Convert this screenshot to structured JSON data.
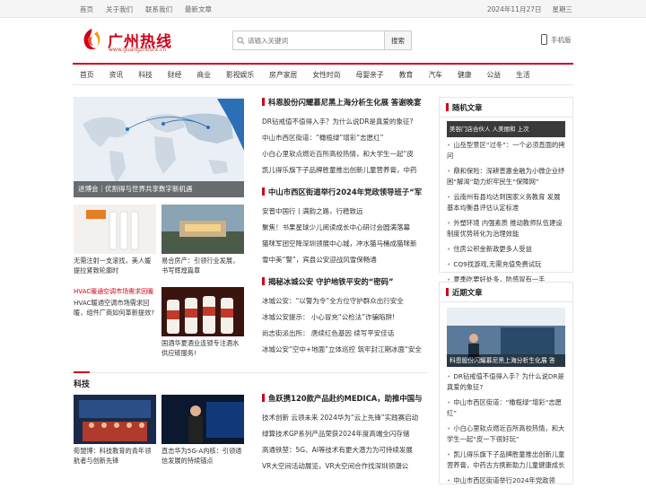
{
  "topbar": {
    "links": [
      "首页",
      "关于我们",
      "联系我们",
      "最新文章"
    ],
    "date": "2024年11月27日",
    "weekday": "星期三"
  },
  "logo": {
    "name": "广州热线",
    "url": "www.guangzhourx.cn"
  },
  "search": {
    "placeholder": "请输入关键词",
    "button": "搜索"
  },
  "mobile": {
    "label": "手机版"
  },
  "nav": [
    "首页",
    "资讯",
    "科技",
    "财经",
    "商业",
    "影视娱乐",
    "房产家居",
    "女性时尚",
    "母婴亲子",
    "教育",
    "汽车",
    "健康",
    "公益",
    "生活"
  ],
  "hero": {
    "caption": "进博会｜优割得与世界共享数字新机遇"
  },
  "thumbs": [
    {
      "caption": "无需注射一支滚找，美人媛提拉紧致轮廓时"
    },
    {
      "caption": "易合房产：引领行业发展，书写辉煌篇章"
    },
    {
      "caption": "HVAC暖通空调市场需求回暖，组件厂商如何革新提效?"
    },
    {
      "caption": "国酒华夏酒业连锁专注酒水供应链服务!"
    },
    {
      "caption": "荀盟博：科技教育的青年领航者与创新先锋"
    },
    {
      "caption": "直击华为5G-A内核：引领通信发展的持续锚点"
    }
  ],
  "broken_image_alt": "HVAC暖通空调市场需求回暖",
  "lists": [
    {
      "head": "科恩股份闪耀慕尼黑上海分析生化展 答谢晚宴",
      "items": [
        "DR钻戒值不值得入手？为什么说DR是真爱的象征?",
        "中山市西区街道：“橄榄绿”增彩“志愿红”",
        "小白心里软点燃近百所高校热情，和大学生一起“皮",
        "凯儿得乐旗下子品牌胜童推出创新儿童营养膏，中药"
      ]
    },
    {
      "head": "中山市西区街道举行2024年党政领导班子“军",
      "items": [
        "安普中国行丨满韵之路，行稳致远",
        "聚焦！书果星球少儿阅读成长中心研讨会圆满落幕",
        "猫咪军团空降深圳领展中心城，冲水猫马桶成猫咪新",
        "雪中美“警”，宾县公安迎战风雪保畅通"
      ]
    },
    {
      "head": "揭秘冰城公安 守护地铁平安的“密码”",
      "items": [
        "冰城公安：“以警为令”全方位守护群众出行安全",
        "冰城公安提示： 小心冒充“公检法”诈骗陷阱!",
        "尚志街派出所： 唐续红色基因 续写平安佳话",
        "冰城公安“空中+地面”立体巡控 筑牢封江期冰面“安全"
      ]
    },
    {
      "head": "鱼跃携120款产品赴约MEDICA，助推中国与",
      "items": [
        "技术创新 云领未来 2024华为“云上先锋”实践赛启动",
        "绿算技术GP系列产品荣获2024年度高端全闪存储",
        "高通铁堃：5G、AI等技术有更大潜力为可持续发展",
        "VR大空间活动展览，VR大空间合作找深圳领潮公"
      ]
    }
  ],
  "section_tech": "科技",
  "random": {
    "title": "随机文章",
    "img_caption": "美容门店合伙人 人美丽和 上次",
    "items": [
      "山岳型景区“过冬”：一个必须直面的拷问",
      "鼎和保险：深耕普惠金融为小微企业纾困“解渴”助力织牢民生“保障网”",
      "云南州有县均达到国家义务教育 发展基本均衡县评估认定标准",
      "外塑环境 内强素质 推动教师队伍建设制度优势转化为治理效能",
      "住房公积金新政更多人受益",
      "CQ9找游戏,无需充值免费试玩",
      "夏季吃要好处多，防感冒有一手"
    ]
  },
  "recent": {
    "title": "近期文章",
    "img_caption": "科恩股份闪耀慕尼黑上海分析生化展 答",
    "items": [
      "DR钻戒值不值得入手？为什么说DR是真爱的象征?",
      "中山市西区街道：“橄榄绿”增彩“志愿红”",
      "小白心里软点燃近百所高校热情，和大学生一起“皮一下很好玩”",
      "凯儿得乐旗下子品牌胜童推出创新儿童营养膏，中药古方携新助力儿童健康成长",
      "中山市西区街道举行2024年党政领"
    ]
  }
}
